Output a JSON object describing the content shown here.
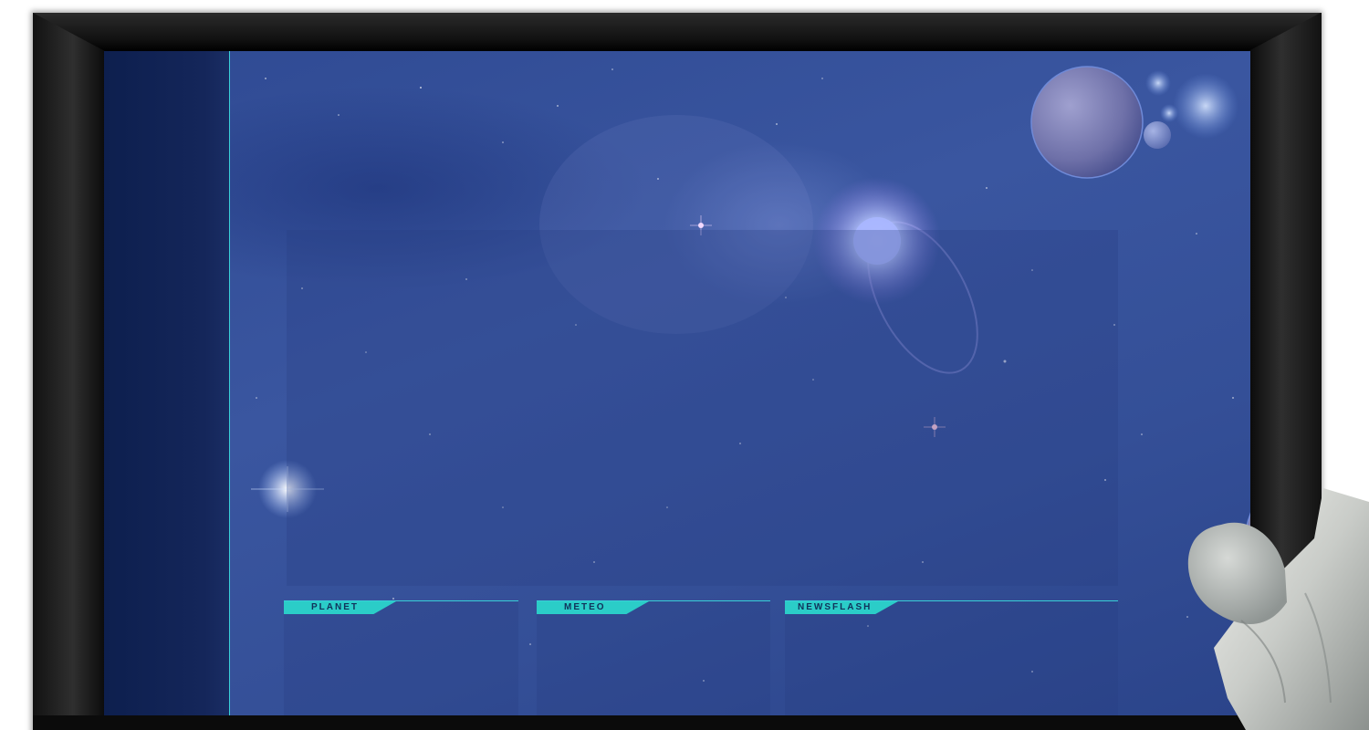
{
  "widgets": [
    {
      "id": "planet",
      "label": "PLANET"
    },
    {
      "id": "meteo",
      "label": "METEO"
    },
    {
      "id": "newsflash",
      "label": "NEWSFLASH"
    }
  ],
  "colors": {
    "accent": "#2bcdc8",
    "screen_bg": "#3a56a0",
    "left_panel_bg": "#0d1f4e",
    "bezel": "#111111"
  }
}
